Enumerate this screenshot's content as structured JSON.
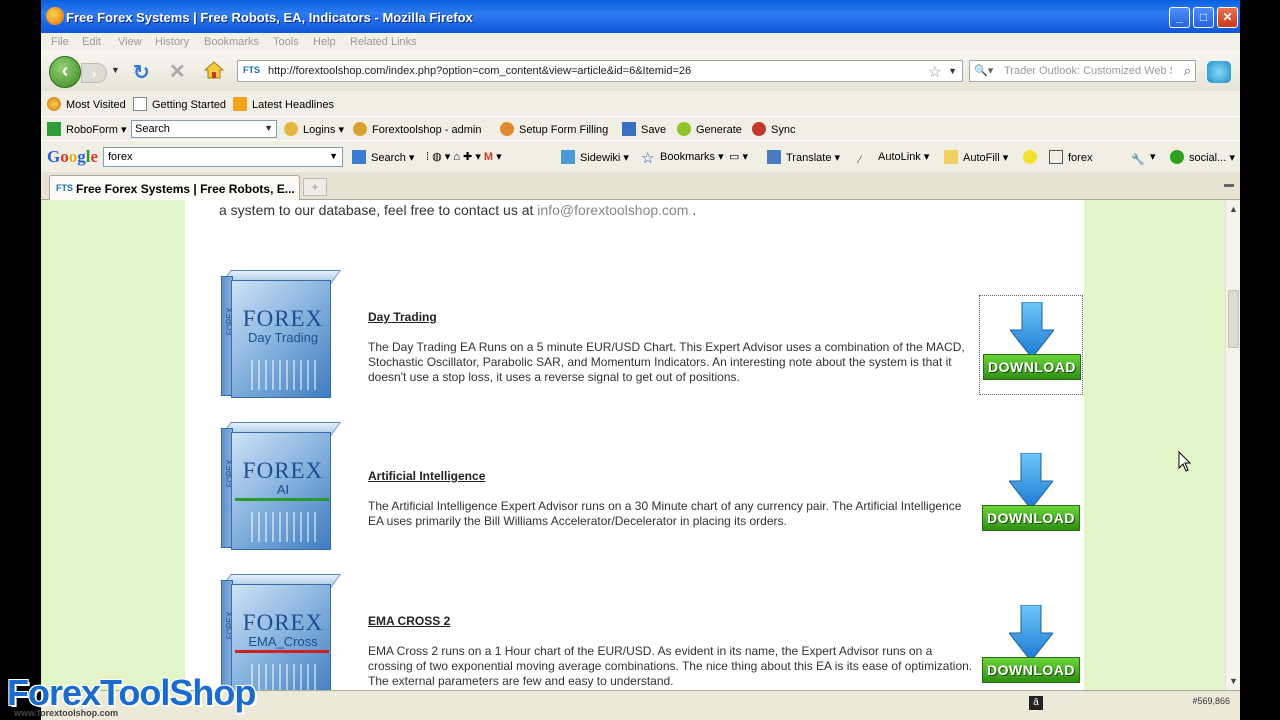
{
  "window": {
    "title": "Free Forex Systems | Free Robots, EA, Indicators - Mozilla Firefox",
    "buttons": [
      "minimize",
      "maximize",
      "close"
    ]
  },
  "menu": [
    "File",
    "Edit",
    "View",
    "History",
    "Bookmarks",
    "Tools",
    "Help",
    "Related Links"
  ],
  "nav": {
    "site_badge": "FTS",
    "url": "http://forextoolshop.com/index.php?option=com_content&view=article&id=6&Itemid=26",
    "search_placeholder": "Trader Outlook: Customized Web Se"
  },
  "bookmarks": [
    "Most Visited",
    "Getting Started",
    "Latest Headlines"
  ],
  "roboform": {
    "label": "RoboForm",
    "search_value": "Search",
    "items": [
      "Logins",
      "Forextoolshop - admin",
      "Setup Form Filling",
      "Save",
      "Generate",
      "Sync"
    ]
  },
  "google": {
    "logo": "Google",
    "query": "forex",
    "items": [
      "Search",
      "Sidewiki",
      "Bookmarks",
      "Translate",
      "AutoLink",
      "AutoFill",
      "forex",
      "social..."
    ]
  },
  "tab": {
    "badge": "FTS",
    "title": "Free Forex Systems | Free Robots, E...",
    "new_tab": "+"
  },
  "page": {
    "intro_text": "a system to our database, feel free to contact us at ",
    "contact_email": "info@forextoolshop.com",
    "intro_end": " .",
    "download_label": "DOWNLOAD",
    "products": [
      {
        "title": "Day Trading",
        "box_brand": "FOREX",
        "box_label": "Day Trading",
        "description": "The Day Trading EA Runs on a 5 minute EUR/USD Chart.  This Expert Advisor uses a combination of the MACD, Stochastic Oscillator, Parabolic SAR, and Momentum Indicators.  An interesting note about the system is that it doesn't use a stop loss, it uses a reverse signal to get out of positions."
      },
      {
        "title": "Artificial Intelligence",
        "box_brand": "FOREX",
        "box_label": "AI",
        "description": "The Artificial Intelligence Expert Advisor runs on a 30 Minute chart of any currency pair.  The Artificial Intelligence EA uses primarily the Bill Williams Accelerator/Decelerator in placing its orders."
      },
      {
        "title": "EMA CROSS  2",
        "box_brand": "FOREX",
        "box_label": "EMA_Cross",
        "description": "EMA Cross 2 runs on a 1 Hour chart of the EUR/USD.  As evident in its name, the Expert Advisor runs on a crossing of two exponential moving average combinations.  The nice thing about this EA is its ease of optimization.  The external parameters are few and easy to understand."
      }
    ]
  },
  "status": {
    "coords": "#569,866"
  },
  "watermark": {
    "logo": "ForexToolShop",
    "sub": "www.forextoolshop.com"
  },
  "colors": {
    "page_bg": "#e2f5c8",
    "download_green": "#3aa01c",
    "link_gray": "#888888",
    "titlebar_blue": "#0a5fe0"
  }
}
